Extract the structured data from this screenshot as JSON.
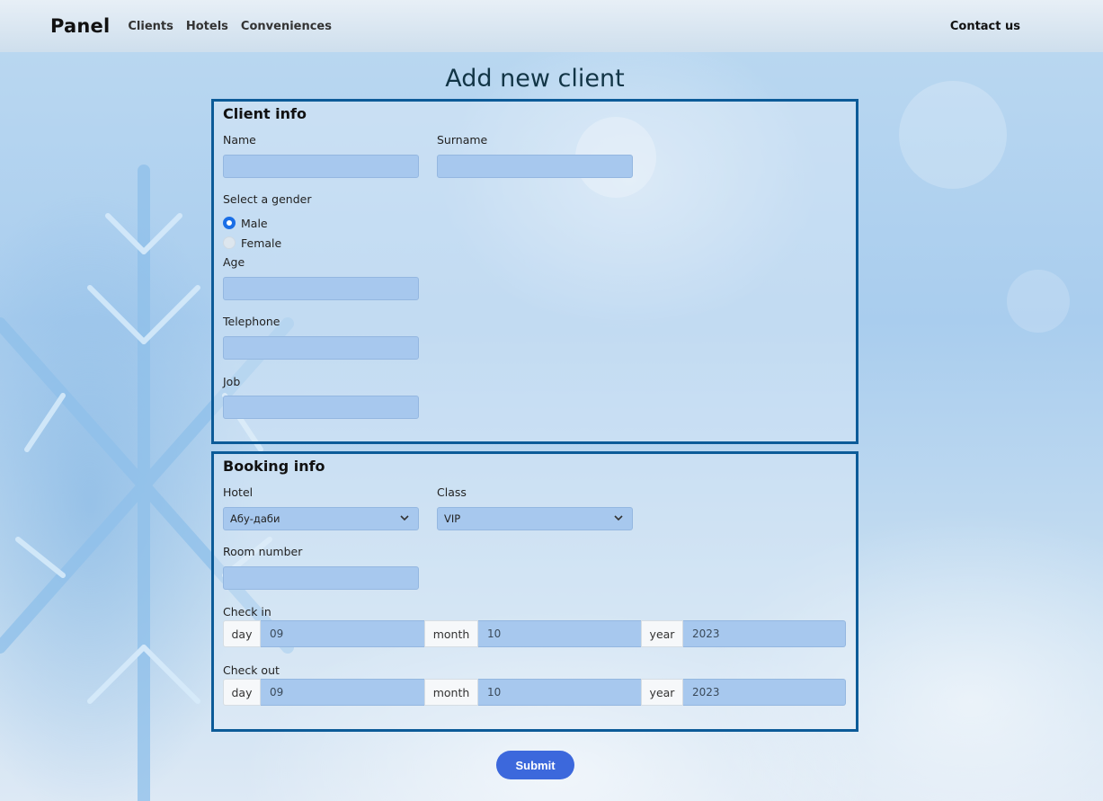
{
  "navbar": {
    "brand": "Panel",
    "links": [
      "Clients",
      "Hotels",
      "Conveniences"
    ],
    "contact": "Contact us"
  },
  "page": {
    "title": "Add new client"
  },
  "client_info": {
    "title": "Client info",
    "name_label": "Name",
    "name_value": "",
    "surname_label": "Surname",
    "surname_value": "",
    "gender_label": "Select a gender",
    "gender_options": [
      "Male",
      "Female"
    ],
    "gender_selected": "Male",
    "age_label": "Age",
    "age_value": "",
    "telephone_label": "Telephone",
    "telephone_value": "",
    "job_label": "Job",
    "job_value": ""
  },
  "booking_info": {
    "title": "Booking info",
    "hotel_label": "Hotel",
    "hotel_value": "Абу-даби",
    "class_label": "Class",
    "class_value": "VIP",
    "room_label": "Room number",
    "room_value": "",
    "check_in": {
      "label": "Check in",
      "day_addon": "day",
      "day_value": "09",
      "month_addon": "month",
      "month_value": "10",
      "year_addon": "year",
      "year_value": "2023"
    },
    "check_out": {
      "label": "Check out",
      "day_addon": "day",
      "day_value": "09",
      "month_addon": "month",
      "month_value": "10",
      "year_addon": "year",
      "year_value": "2023"
    }
  },
  "submit_label": "Submit",
  "colors": {
    "panel_border": "#0c5b98",
    "input_bg": "#a7c8ee",
    "submit_bg": "#3c68dc",
    "radio_checked": "#1a6ee6"
  }
}
